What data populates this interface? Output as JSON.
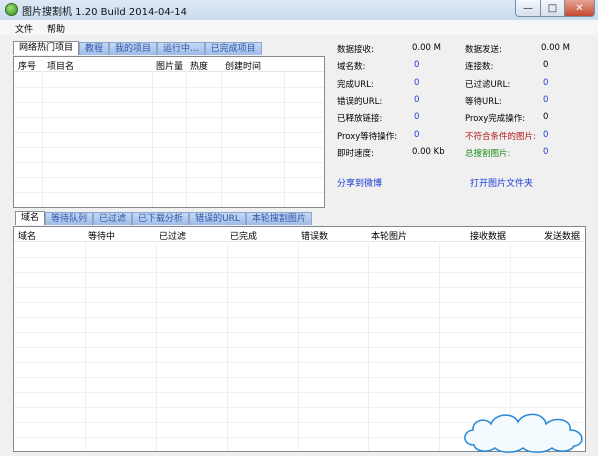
{
  "window": {
    "title": "图片搜割机 1.20 Build 2014-04-14"
  },
  "menu": {
    "items": [
      "文件",
      "帮助"
    ]
  },
  "top_tabs": [
    "网络热门项目",
    "教程",
    "我的项目",
    "运行中...",
    "已完成项目"
  ],
  "projects_table": {
    "columns": [
      "序号",
      "项目名",
      "图片量",
      "热度",
      "创建时间"
    ]
  },
  "stats": {
    "left": [
      {
        "label": "数据接收:",
        "value": "0.00 M",
        "blue": false
      },
      {
        "label": "域名数:",
        "value": "0",
        "blue": true
      },
      {
        "label": "完成URL:",
        "value": "0",
        "blue": true
      },
      {
        "label": "错误的URL:",
        "value": "0",
        "blue": true
      },
      {
        "label": "已释放链接:",
        "value": "0",
        "blue": true
      },
      {
        "label": "Proxy等待操作:",
        "value": "0",
        "blue": true
      },
      {
        "label": "即时速度:",
        "value": "0.00 Kb",
        "blue": false
      }
    ],
    "right": [
      {
        "label": "数据发送:",
        "value": "0.00 M",
        "color": ""
      },
      {
        "label": "连接数:",
        "value": "0",
        "color": ""
      },
      {
        "label": "已过滤URL:",
        "value": "0",
        "color": "blue"
      },
      {
        "label": "等待URL:",
        "value": "0",
        "color": "blue"
      },
      {
        "label": "Proxy完成操作:",
        "value": "0",
        "color": ""
      },
      {
        "label": "不符合条件的图片:",
        "value": "0",
        "color": "red"
      },
      {
        "label": "总搜割图片:",
        "value": "0",
        "color": "green"
      }
    ]
  },
  "links": {
    "share": "分享到微博",
    "open_folder": "打开图片文件夹"
  },
  "bottom_tabs": [
    "域名",
    "等待队列",
    "已过滤",
    "已下载分析",
    "错误的URL",
    "本轮搜割图片"
  ],
  "domain_table": {
    "columns": [
      "域名",
      "等待中",
      "已过滤",
      "已完成",
      "错误数",
      "本轮图片",
      "接收数据",
      "发送数据"
    ]
  },
  "colors": {
    "tab_blue": "#2d57a8",
    "link_blue": "#1a3bd6",
    "warn_red": "#b41717",
    "ok_green": "#1a8a1a"
  }
}
